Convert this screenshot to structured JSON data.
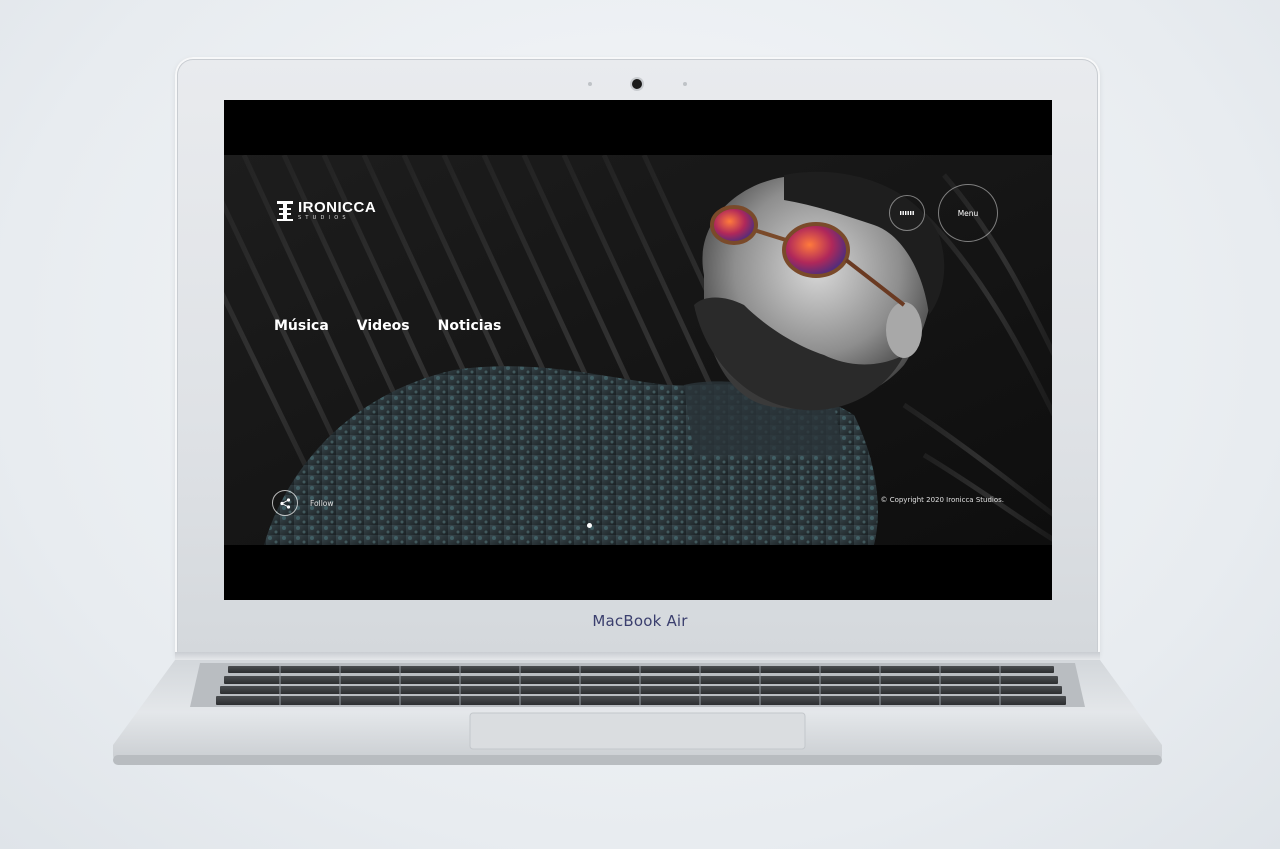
{
  "laptop": {
    "model_label": "MacBook Air"
  },
  "site": {
    "logo": {
      "name": "IRONICCA",
      "subtitle": "STUDIOS"
    },
    "nav": {
      "items": [
        {
          "label": "Música"
        },
        {
          "label": "Videos"
        },
        {
          "label": "Noticias"
        }
      ]
    },
    "header_buttons": {
      "menu_label": "Menu",
      "lang_icon": "bars-icon"
    },
    "footer": {
      "follow_label": "Follow",
      "copyright": "© Copyright 2020 Ironicca Studios."
    },
    "slider": {
      "active_index": 1,
      "total": 1
    },
    "colors": {
      "background": "#151515",
      "text": "#ffffff",
      "accent_glasses": "#c0392b"
    }
  }
}
